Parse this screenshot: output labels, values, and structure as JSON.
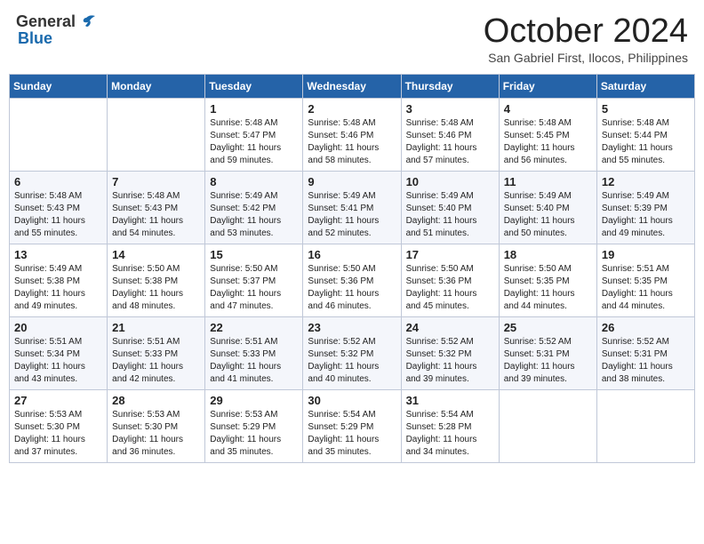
{
  "header": {
    "logo_general": "General",
    "logo_blue": "Blue",
    "month_title": "October 2024",
    "location": "San Gabriel First, Ilocos, Philippines"
  },
  "weekdays": [
    "Sunday",
    "Monday",
    "Tuesday",
    "Wednesday",
    "Thursday",
    "Friday",
    "Saturday"
  ],
  "weeks": [
    [
      {
        "day": "",
        "info": ""
      },
      {
        "day": "",
        "info": ""
      },
      {
        "day": "1",
        "info": "Sunrise: 5:48 AM\nSunset: 5:47 PM\nDaylight: 11 hours and 59 minutes."
      },
      {
        "day": "2",
        "info": "Sunrise: 5:48 AM\nSunset: 5:46 PM\nDaylight: 11 hours and 58 minutes."
      },
      {
        "day": "3",
        "info": "Sunrise: 5:48 AM\nSunset: 5:46 PM\nDaylight: 11 hours and 57 minutes."
      },
      {
        "day": "4",
        "info": "Sunrise: 5:48 AM\nSunset: 5:45 PM\nDaylight: 11 hours and 56 minutes."
      },
      {
        "day": "5",
        "info": "Sunrise: 5:48 AM\nSunset: 5:44 PM\nDaylight: 11 hours and 55 minutes."
      }
    ],
    [
      {
        "day": "6",
        "info": "Sunrise: 5:48 AM\nSunset: 5:43 PM\nDaylight: 11 hours and 55 minutes."
      },
      {
        "day": "7",
        "info": "Sunrise: 5:48 AM\nSunset: 5:43 PM\nDaylight: 11 hours and 54 minutes."
      },
      {
        "day": "8",
        "info": "Sunrise: 5:49 AM\nSunset: 5:42 PM\nDaylight: 11 hours and 53 minutes."
      },
      {
        "day": "9",
        "info": "Sunrise: 5:49 AM\nSunset: 5:41 PM\nDaylight: 11 hours and 52 minutes."
      },
      {
        "day": "10",
        "info": "Sunrise: 5:49 AM\nSunset: 5:40 PM\nDaylight: 11 hours and 51 minutes."
      },
      {
        "day": "11",
        "info": "Sunrise: 5:49 AM\nSunset: 5:40 PM\nDaylight: 11 hours and 50 minutes."
      },
      {
        "day": "12",
        "info": "Sunrise: 5:49 AM\nSunset: 5:39 PM\nDaylight: 11 hours and 49 minutes."
      }
    ],
    [
      {
        "day": "13",
        "info": "Sunrise: 5:49 AM\nSunset: 5:38 PM\nDaylight: 11 hours and 49 minutes."
      },
      {
        "day": "14",
        "info": "Sunrise: 5:50 AM\nSunset: 5:38 PM\nDaylight: 11 hours and 48 minutes."
      },
      {
        "day": "15",
        "info": "Sunrise: 5:50 AM\nSunset: 5:37 PM\nDaylight: 11 hours and 47 minutes."
      },
      {
        "day": "16",
        "info": "Sunrise: 5:50 AM\nSunset: 5:36 PM\nDaylight: 11 hours and 46 minutes."
      },
      {
        "day": "17",
        "info": "Sunrise: 5:50 AM\nSunset: 5:36 PM\nDaylight: 11 hours and 45 minutes."
      },
      {
        "day": "18",
        "info": "Sunrise: 5:50 AM\nSunset: 5:35 PM\nDaylight: 11 hours and 44 minutes."
      },
      {
        "day": "19",
        "info": "Sunrise: 5:51 AM\nSunset: 5:35 PM\nDaylight: 11 hours and 44 minutes."
      }
    ],
    [
      {
        "day": "20",
        "info": "Sunrise: 5:51 AM\nSunset: 5:34 PM\nDaylight: 11 hours and 43 minutes."
      },
      {
        "day": "21",
        "info": "Sunrise: 5:51 AM\nSunset: 5:33 PM\nDaylight: 11 hours and 42 minutes."
      },
      {
        "day": "22",
        "info": "Sunrise: 5:51 AM\nSunset: 5:33 PM\nDaylight: 11 hours and 41 minutes."
      },
      {
        "day": "23",
        "info": "Sunrise: 5:52 AM\nSunset: 5:32 PM\nDaylight: 11 hours and 40 minutes."
      },
      {
        "day": "24",
        "info": "Sunrise: 5:52 AM\nSunset: 5:32 PM\nDaylight: 11 hours and 39 minutes."
      },
      {
        "day": "25",
        "info": "Sunrise: 5:52 AM\nSunset: 5:31 PM\nDaylight: 11 hours and 39 minutes."
      },
      {
        "day": "26",
        "info": "Sunrise: 5:52 AM\nSunset: 5:31 PM\nDaylight: 11 hours and 38 minutes."
      }
    ],
    [
      {
        "day": "27",
        "info": "Sunrise: 5:53 AM\nSunset: 5:30 PM\nDaylight: 11 hours and 37 minutes."
      },
      {
        "day": "28",
        "info": "Sunrise: 5:53 AM\nSunset: 5:30 PM\nDaylight: 11 hours and 36 minutes."
      },
      {
        "day": "29",
        "info": "Sunrise: 5:53 AM\nSunset: 5:29 PM\nDaylight: 11 hours and 35 minutes."
      },
      {
        "day": "30",
        "info": "Sunrise: 5:54 AM\nSunset: 5:29 PM\nDaylight: 11 hours and 35 minutes."
      },
      {
        "day": "31",
        "info": "Sunrise: 5:54 AM\nSunset: 5:28 PM\nDaylight: 11 hours and 34 minutes."
      },
      {
        "day": "",
        "info": ""
      },
      {
        "day": "",
        "info": ""
      }
    ]
  ]
}
